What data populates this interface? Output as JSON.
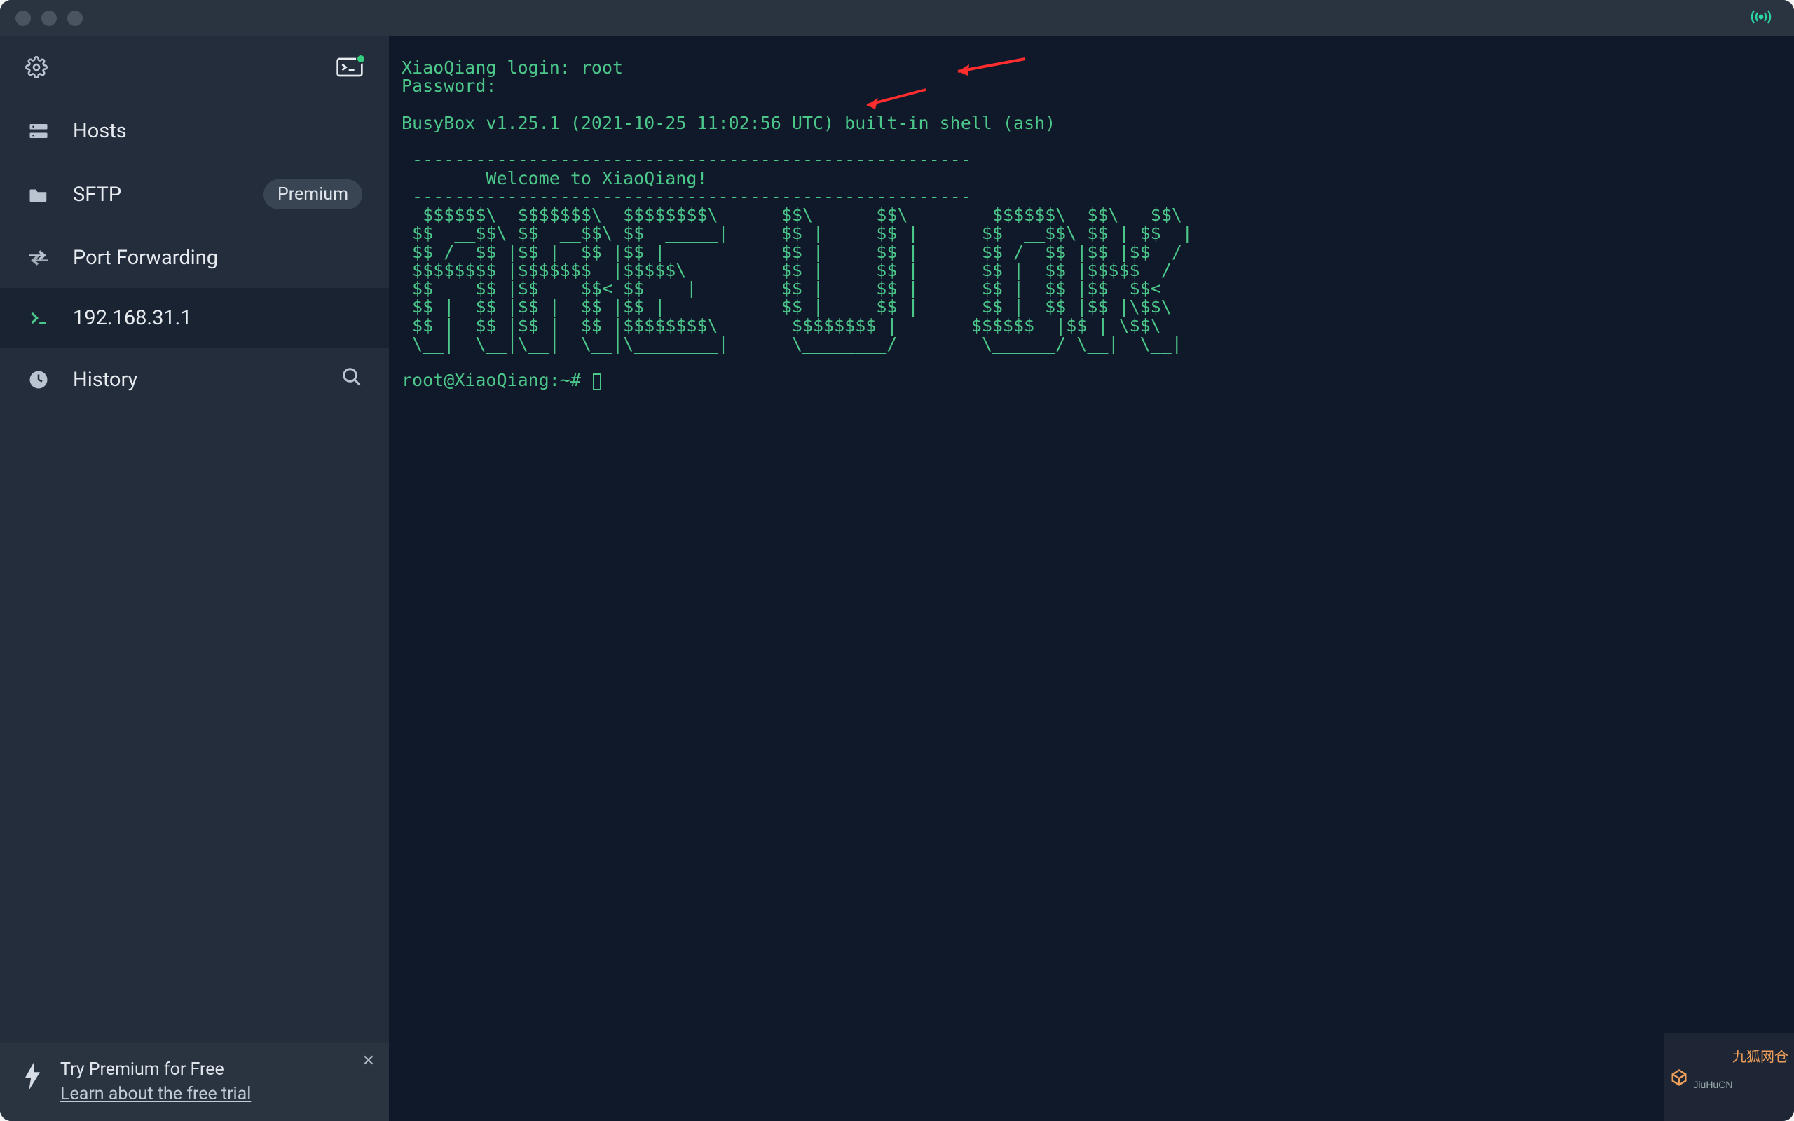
{
  "sidebar": {
    "items": [
      {
        "label": "Hosts",
        "icon": "hosts"
      },
      {
        "label": "SFTP",
        "icon": "folder",
        "premium": true,
        "premium_label": "Premium"
      },
      {
        "label": "Port Forwarding",
        "icon": "forward"
      },
      {
        "label": "192.168.31.1",
        "icon": "prompt",
        "active": true
      },
      {
        "label": "History",
        "icon": "clock",
        "search": true
      }
    ]
  },
  "premium_banner": {
    "line1": "Try Premium for Free",
    "line2": "Learn about the free trial"
  },
  "terminal": {
    "login_line": "XiaoQiang login: root",
    "password_line": "Password:",
    "busybox_line": "BusyBox v1.25.1 (2021-10-25 11:02:56 UTC) built-in shell (ash)",
    "banner": " -----------------------------------------------------\n        Welcome to XiaoQiang!\n -----------------------------------------------------\n  $$$$$$\\  $$$$$$$\\  $$$$$$$$\\      $$\\      $$\\        $$$$$$\\  $$\\   $$\\\n $$  __$$\\ $$  __$$\\ $$  _____|     $$ |     $$ |      $$  __$$\\ $$ | $$  |\n $$ /  $$ |$$ |  $$ |$$ |           $$ |     $$ |      $$ /  $$ |$$ |$$  /\n $$$$$$$$ |$$$$$$$  |$$$$$\\         $$ |     $$ |      $$ |  $$ |$$$$$  /\n $$  __$$ |$$  __$$< $$  __|        $$ |     $$ |      $$ |  $$ |$$  $$<\n $$ |  $$ |$$ |  $$ |$$ |           $$ |     $$ |      $$ |  $$ |$$ |\\$$\\\n $$ |  $$ |$$ |  $$ |$$$$$$$$\\       $$$$$$$$ |       $$$$$$  |$$ | \\$$\\\n \\__|  \\__|\\__|  \\__|\\________|      \\________/        \\______/ \\__|  \\__|",
    "prompt": "root@XiaoQiang:~# "
  },
  "colors": {
    "terminal_text": "#4cc78a",
    "sidebar_bg": "#232d3b",
    "terminal_bg": "#10192a",
    "arrow": "#ff2d2d"
  },
  "watermark": {
    "text": "九狐网仓",
    "sub": "JiuHuCN"
  }
}
